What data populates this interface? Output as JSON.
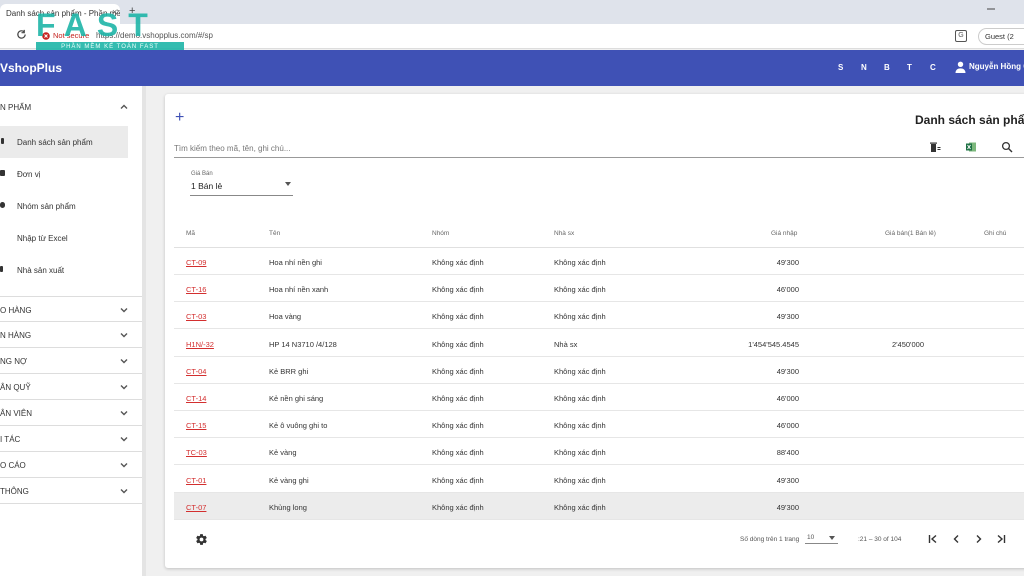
{
  "browser": {
    "tab_title": "Danh sách sản phẩm - Phần mề",
    "tab_close": "×",
    "new_tab": "+",
    "not_secure": "Not secure",
    "url": "https://demo.vshopplus.com/#/sp",
    "guest": "Guest (2"
  },
  "watermark": {
    "logo": "FAST",
    "sub": "PHẦN MỀM KẾ TOÁN FAST"
  },
  "appbar": {
    "brand": "VshopPlus",
    "links": [
      "S",
      "N",
      "B",
      "T",
      "C"
    ],
    "user": "Nguyễn Hồng G"
  },
  "sidebar": {
    "open_group": "N PHẨM",
    "items": [
      {
        "label": "Danh sách sản phẩm",
        "active": true
      },
      {
        "label": "Đơn vị",
        "active": false
      },
      {
        "label": "Nhóm sản phẩm",
        "active": false
      },
      {
        "label": "Nhập từ Excel",
        "active": false
      },
      {
        "label": "Nhà sản xuất",
        "active": false
      }
    ],
    "groups": [
      "O HÀNG",
      "N HÀNG",
      "NG NỢ",
      "ÂN QUỸ",
      "ÂN VIÊN",
      "I TÁC",
      "O CÁO",
      "THÔNG"
    ]
  },
  "main": {
    "add": "+",
    "title": "Danh sách sản phẩm",
    "search_placeholder": "Tìm kiếm theo mã, tên, ghi chú...",
    "price_caption": "Giá Bán",
    "price_value": "1 Bán lẻ",
    "columns": {
      "code": "Mã",
      "name": "Tên",
      "group": "Nhóm",
      "maker": "Nhà sx",
      "cost": "Giá nhập",
      "price": "Giá bán(1 Bán lẻ)",
      "note": "Ghi chú"
    },
    "rows": [
      {
        "code": "CT-09",
        "name": "Hoa nhí nền ghi",
        "group": "Không xác định",
        "maker": "Không xác định",
        "cost": "49'300",
        "price": ""
      },
      {
        "code": "CT-16",
        "name": "Hoa nhí nền xanh",
        "group": "Không xác định",
        "maker": "Không xác định",
        "cost": "46'000",
        "price": ""
      },
      {
        "code": "CT-03",
        "name": "Hoa vàng",
        "group": "Không xác định",
        "maker": "Không xác định",
        "cost": "49'300",
        "price": ""
      },
      {
        "code": "H1N/-32",
        "name": "HP 14 N3710 /4/128",
        "group": "Không xác định",
        "maker": "Nhà sx",
        "cost": "1'454'545.4545",
        "price": "2'450'000"
      },
      {
        "code": "CT-04",
        "name": "Kẻ BRR ghi",
        "group": "Không xác định",
        "maker": "Không xác định",
        "cost": "49'300",
        "price": ""
      },
      {
        "code": "CT-14",
        "name": "Kẻ nền ghi sáng",
        "group": "Không xác định",
        "maker": "Không xác định",
        "cost": "46'000",
        "price": ""
      },
      {
        "code": "CT-15",
        "name": "Kẻ ô vuông ghi to",
        "group": "Không xác định",
        "maker": "Không xác định",
        "cost": "46'000",
        "price": ""
      },
      {
        "code": "TC-03",
        "name": "Kẻ vàng",
        "group": "Không xác định",
        "maker": "Không xác định",
        "cost": "88'400",
        "price": ""
      },
      {
        "code": "CT-01",
        "name": "Kẻ vàng ghi",
        "group": "Không xác định",
        "maker": "Không xác định",
        "cost": "49'300",
        "price": ""
      },
      {
        "code": "CT-07",
        "name": "Khủng long",
        "group": "Không xác định",
        "maker": "Không xác định",
        "cost": "49'300",
        "price": "",
        "highlight": true
      }
    ],
    "pagination": {
      "rows_label": "Số dòng trên 1 trang",
      "rows_value": "10",
      "range": ":21 – 30 of 104"
    }
  },
  "colors": {
    "primary": "#3f51b5",
    "link_red": "#d32f2f",
    "watermark": "#1fb5a8"
  }
}
